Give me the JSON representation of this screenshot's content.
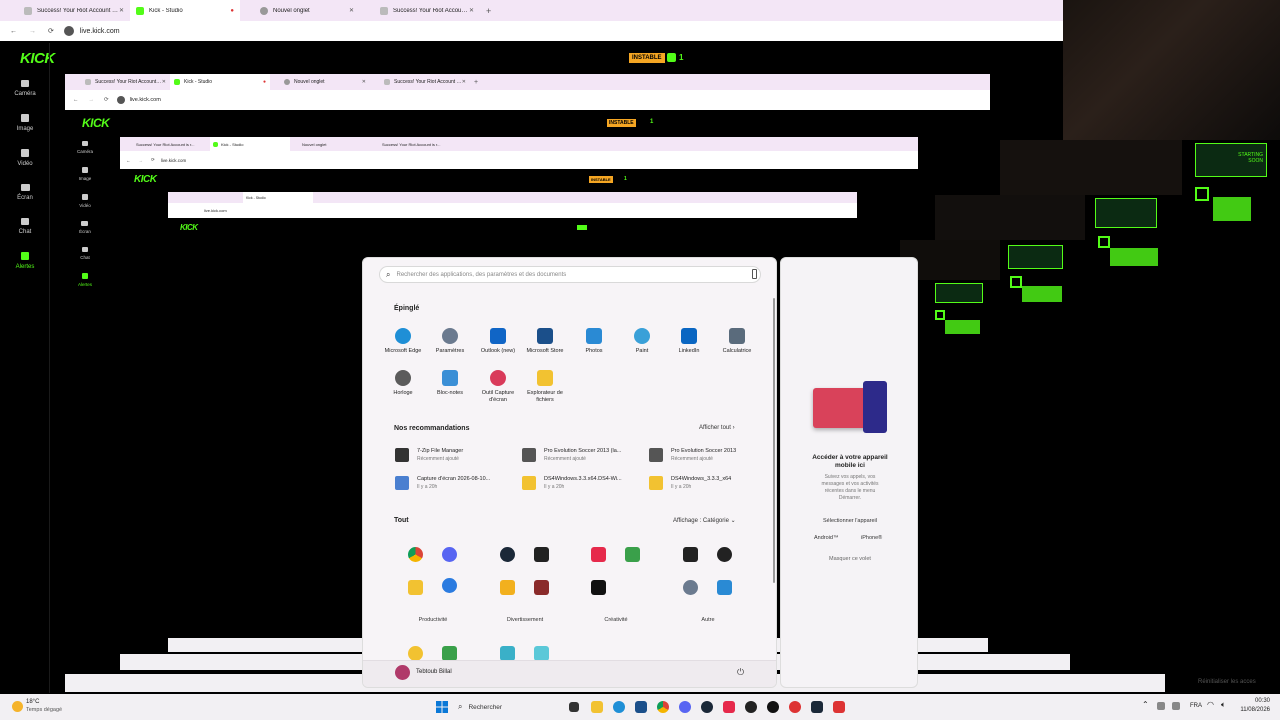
{
  "browser": {
    "tabs": [
      {
        "label": "Success! Your Riot Account is r...",
        "active": false
      },
      {
        "label": "Kick - Studio",
        "active": true
      },
      {
        "label": "Nouvel onglet",
        "active": false
      },
      {
        "label": "Success! Your Riot Account is r...",
        "active": false
      }
    ],
    "new_tab": "+",
    "url": "live.kick.com"
  },
  "kick": {
    "logo": "KICK",
    "status_badge": "INSTABLE",
    "viewer_count": "1",
    "nav": [
      {
        "label": "Caméra",
        "icon": "camera-icon"
      },
      {
        "label": "Image",
        "icon": "image-icon"
      },
      {
        "label": "Vidéo",
        "icon": "video-icon"
      },
      {
        "label": "Écran",
        "icon": "screen-icon"
      },
      {
        "label": "Chat",
        "icon": "chat-icon"
      },
      {
        "label": "Alertes",
        "icon": "alert-icon"
      }
    ]
  },
  "start_menu": {
    "search_placeholder": "Rechercher des applications, des paramètres et des documents",
    "pinned_title": "Épinglé",
    "pinned": [
      {
        "label": "Microsoft Edge",
        "color": "#1f8fd6"
      },
      {
        "label": "Paramètres",
        "color": "#6b7a8f"
      },
      {
        "label": "Outlook (new)",
        "color": "#1065c6"
      },
      {
        "label": "Microsoft Store",
        "color": "#1b4f8a"
      },
      {
        "label": "Photos",
        "color": "#2a8ad4"
      },
      {
        "label": "Paint",
        "color": "#3aa0d8"
      },
      {
        "label": "LinkedIn",
        "color": "#0a66c2"
      },
      {
        "label": "Calculatrice",
        "color": "#5a6b7c"
      },
      {
        "label": "Horloge",
        "color": "#5b5b5b"
      },
      {
        "label": "Bloc-notes",
        "color": "#3b8fd6"
      },
      {
        "label": "Outil Capture d'écran",
        "color": "#d93a5a"
      },
      {
        "label": "Explorateur de fichiers",
        "color": "#f2c231"
      }
    ],
    "reco_title": "Nos recommandations",
    "reco_more": "Afficher tout",
    "recommendations": [
      {
        "name": "7-Zip File Manager",
        "sub": "Récemment ajouté",
        "color": "#333"
      },
      {
        "name": "Pro Evolution Soccer 2013 (la...",
        "sub": "Récemment ajouté",
        "color": "#555"
      },
      {
        "name": "Pro Evolution Soccer 2013",
        "sub": "Récemment ajouté",
        "color": "#555"
      },
      {
        "name": "Capture d'écran 2026-08-10...",
        "sub": "Il y a 20h",
        "color": "#4a7fd0"
      },
      {
        "name": "DS4Windows.3.3.x64.DS4-Wi...",
        "sub": "Il y a 20h",
        "color": "#f2c231"
      },
      {
        "name": "DS4Windows_3.3.3_x64",
        "sub": "Il y a 20h",
        "color": "#f2c231"
      }
    ],
    "all_title": "Tout",
    "all_view": "Affichage : Catégorie",
    "categories": [
      "Productivité",
      "Divertissement",
      "Créativité",
      "Autre"
    ],
    "user": "Tebtoub Billal"
  },
  "phone_panel": {
    "title": "Accéder à votre appareil mobile ici",
    "desc": "Suivez vos appels, vos messages et vos activités récentes dans le menu Démarrer.",
    "select": "Sélectionner l'appareil",
    "android": "Android™",
    "iphone": "iPhone®",
    "hide": "Masquer ce volet"
  },
  "taskbar": {
    "weather_temp": "18°C",
    "weather_desc": "Temps dégagé",
    "search": "Rechercher",
    "lang": "FRA",
    "time": "00:30",
    "date": "11/08/2026"
  },
  "activation": "Réinitialiser les acces",
  "overlay": {
    "label": "STARTING SOON"
  }
}
